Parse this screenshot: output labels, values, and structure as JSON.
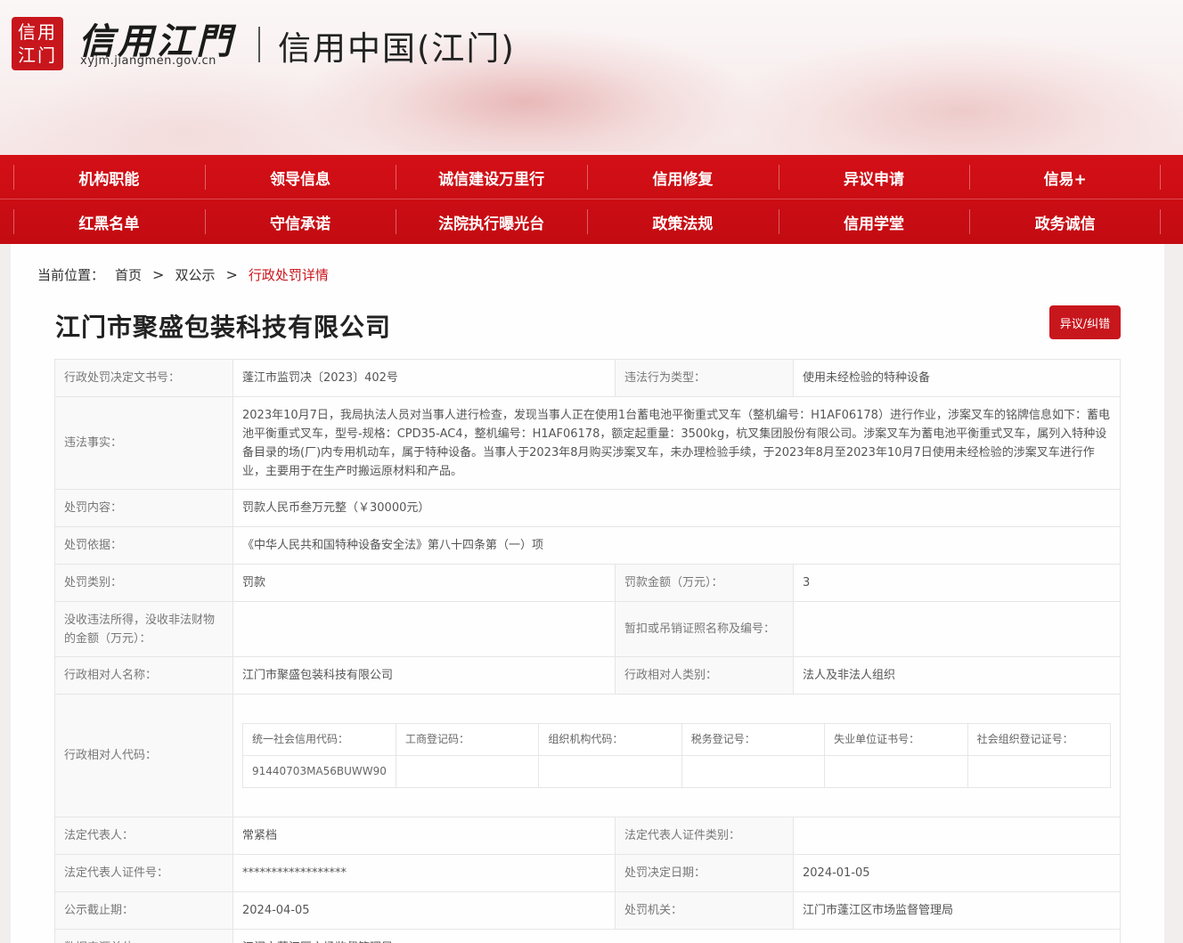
{
  "header": {
    "logo_seal": "信用江门",
    "logo_text": "信用江門",
    "logo_url": "xyjm.jiangmen.gov.cn",
    "site_title": "信用中国(江门)"
  },
  "nav": {
    "row1": [
      "机构职能",
      "领导信息",
      "诚信建设万里行",
      "信用修复",
      "异议申请",
      "信易+"
    ],
    "row2": [
      "红黑名单",
      "守信承诺",
      "法院执行曝光台",
      "政策法规",
      "信用学堂",
      "政务诚信"
    ]
  },
  "breadcrumb": {
    "label": "当前位置：",
    "home": "首页",
    "sep": ">",
    "level1": "双公示",
    "current": "行政处罚详情"
  },
  "company_title": "江门市聚盛包装科技有限公司",
  "objection_button": "异议/纠错",
  "table": {
    "decision_no_label": "行政处罚决定文书号：",
    "decision_no": "蓬江市监罚决〔2023〕402号",
    "violation_type_label": "违法行为类型：",
    "violation_type": "使用未经检验的特种设备",
    "facts_label": "违法事实：",
    "facts": "2023年10月7日，我局执法人员对当事人进行检查，发现当事人正在使用1台蓄电池平衡重式叉车（整机编号：H1AF06178）进行作业，涉案叉车的铭牌信息如下：蓄电池平衡重式叉车，型号-规格：CPD35-AC4，整机编号：H1AF06178，额定起重量：3500kg，杭叉集团股份有限公司。涉案叉车为蓄电池平衡重式叉车，属列入特种设备目录的场(厂)内专用机动车，属于特种设备。当事人于2023年8月购买涉案叉车，未办理检验手续，于2023年8月至2023年10月7日使用未经检验的涉案叉车进行作业，主要用于在生产时搬运原材料和产品。",
    "content_label": "处罚内容：",
    "content": "罚款人民币叁万元整（￥30000元）",
    "basis_label": "处罚依据：",
    "basis": "《中华人民共和国特种设备安全法》第八十四条第（一）项",
    "category_label": "处罚类别：",
    "category": "罚款",
    "fine_label": "罚款金额（万元）：",
    "fine": "3",
    "confiscation_label": "没收违法所得，没收非法财物的金额（万元）：",
    "confiscation": "",
    "license_label": "暂扣或吊销证照名称及编号：",
    "license": "",
    "party_name_label": "行政相对人名称：",
    "party_name": "江门市聚盛包装科技有限公司",
    "party_type_label": "行政相对人类别：",
    "party_type": "法人及非法人组织",
    "party_code_label": "行政相对人代码：",
    "code_headers": [
      "统一社会信用代码：",
      "工商登记码：",
      "组织机构代码：",
      "税务登记号：",
      "失业单位证书号：",
      "社会组织登记证号："
    ],
    "code_values": [
      "91440703MA56BUWW90",
      "",
      "",
      "",
      "",
      ""
    ],
    "legal_rep_label": "法定代表人：",
    "legal_rep": "常紧档",
    "legal_rep_id_type_label": "法定代表人证件类别：",
    "legal_rep_id_type": "",
    "legal_rep_id_label": "法定代表人证件号：",
    "legal_rep_id": "******************",
    "decision_date_label": "处罚决定日期：",
    "decision_date": "2024-01-05",
    "publish_end_label": "公示截止期：",
    "publish_end": "2024-04-05",
    "authority_label": "处罚机关：",
    "authority": "江门市蓬江区市场监督管理局",
    "source_label": "数据来源单位：",
    "source": "江门市蓬江区市场监督管理局"
  }
}
